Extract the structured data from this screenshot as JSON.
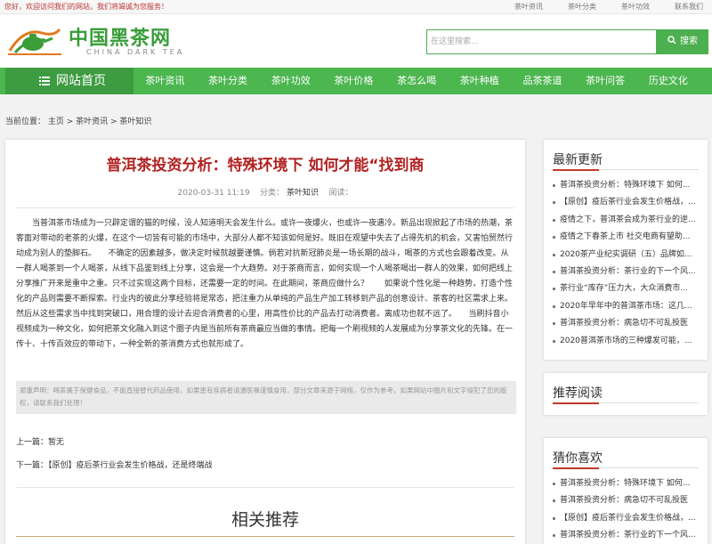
{
  "topbar": {
    "welcome": "您好，欢迎访问我们的网站，我们将竭诚为您服务！",
    "links": [
      "茶叶资讯",
      "茶叶分类",
      "茶叶功效",
      "联系我们"
    ]
  },
  "logo": {
    "cn": "中国黑茶网",
    "en": "CHINA DARK TEA"
  },
  "search": {
    "placeholder": "在这里搜索...",
    "button": "搜索"
  },
  "nav": {
    "home": "网站首页",
    "items": [
      "茶叶资讯",
      "茶叶分类",
      "茶叶功效",
      "茶叶价格",
      "茶怎么喝",
      "茶叶种植",
      "品茶茶道",
      "茶叶问答",
      "历史文化"
    ]
  },
  "breadcrumb": "当前位置： 主页 > 茶叶资讯 > 茶叶知识",
  "article": {
    "title": "普洱茶投资分析：特殊环境下 如何才能“找到商",
    "date": "2020-03-31 11:19",
    "category_label": "分类：",
    "category": "茶叶知识",
    "reads_label": "阅读：",
    "body": "当普洱茶市场成为一只辟定谓的猫的时候，没人知道明天会发生什么。或许一夜爆火，也或许一夜遇冷。新品出现掀起了市场的热潮，茶客面对带动的老茶的火爆，在这个一切皆有可能的市场中，大部分人都不知该如何是好。既旧在观望中失去了占得先机的机会，又害怕贸然行动成为别人的垫脚石。　　不确定的因素越多，做决定时候就越要谨慎。倘若对抗新冠肺炎是一场长期的战斗，喝茶的方式也会跟着改变。从一群人喝茶到一个人喝茶，从线下品鉴到线上分享，这会是一个大趋势。对于茶商而言，如何实现一个人喝茶喝出一群人的效果，如何把线上分享推广开来是重中之重。只不过实现这两个目标，还需要一定的时间。在此期间，茶商应做什么？　　如果说个性化是一种趋势，打造个性化的产品则需要不断探索。行业内的彼此分享经验将是常态，把注重力从单纯的产品生产加工转移到产品的创意设计、茶客的社区需求上来。然后从这些需求当中找到突破口，用合理的设计去迎合消费者的心里，用高性价比的产品去打动消费者。离成功也就不远了。　　当刷抖音小视频成为一种文化，如何把茶文化融入到这个圈子内是当前所有茶商最应当做的事情。把每一个刷视频的人发展成为分享茶文化的先锋。在一传十、十传百效应的带动下，一种全新的茶消费方式也就形成了。",
    "disclaimer": "郑重声明：喝茶属于保健食品，不能直接替代药品使用，如果患有疾病者请遵医嘱谨慎食用，部分文章来源于网络，仅作为参考，如果网站中图片和文字侵犯了您的版权，请联系我们处理！",
    "prev": "上一篇：暂无",
    "next": "下一篇：【原创】疫后茶行业会发生价格战，还是终端战",
    "related": "相关推荐"
  },
  "sidebar": {
    "latest_title": "最新更新",
    "latest": [
      "普洱茶投资分析：特殊环境下 如何...",
      "【原创】疫后茶行业会发生价格战，...",
      "疫情之下，普洱茶会成为茶行业的逆...",
      "疫情之下春茶上市 社交电商有望助...",
      "2020茶产业纪实调研（五）品牌如...",
      "普洱茶投资分析：茶行业的下一个风...",
      "茶行业“库存”压力大，大众消费市...",
      "2020年早年中的普洱茶市场：这几...",
      "普洱茶投资分析：病急切不可乱投医",
      "2020普洱茶市场的三种爆发可能，..."
    ],
    "recommend_title": "推荐阅读",
    "guess_title": "猜你喜欢",
    "guess": [
      "普洱茶投资分析：特殊环境下 如何...",
      "普洱茶投资分析：病急切不可乱投医",
      "【原创】疫后茶行业会发生价格战，...",
      "普洱茶投资分析：茶行业的下一个风..."
    ]
  }
}
